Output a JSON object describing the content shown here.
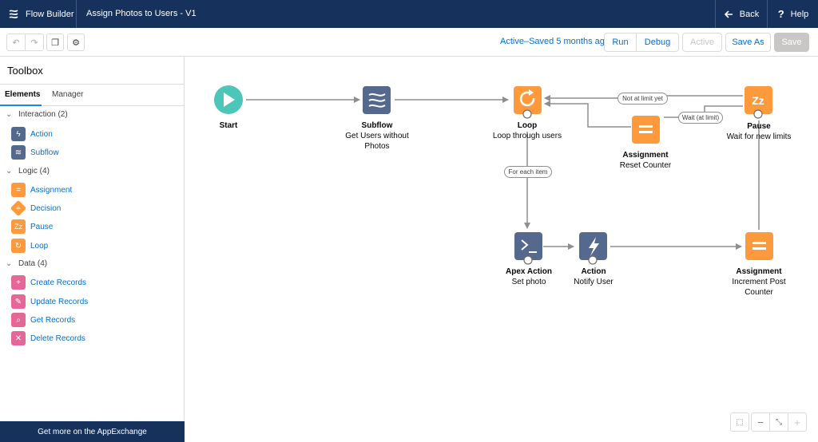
{
  "header": {
    "app_name": "Flow Builder",
    "flow_title": "Assign Photos to Users - V1",
    "back_label": "Back",
    "help_label": "Help"
  },
  "toolbar": {
    "status": "Active–Saved 5 months ago",
    "run_label": "Run",
    "debug_label": "Debug",
    "active_label": "Active",
    "save_as_label": "Save As",
    "save_label": "Save"
  },
  "sidebar": {
    "title": "Toolbox",
    "tabs": [
      "Elements",
      "Manager"
    ],
    "groups": [
      {
        "label": "Interaction (2)",
        "items": [
          {
            "label": "Action",
            "icon": "lightning-icon",
            "color": "#54698d"
          },
          {
            "label": "Subflow",
            "icon": "subflow-icon",
            "color": "#54698d"
          }
        ]
      },
      {
        "label": "Logic (4)",
        "items": [
          {
            "label": "Assignment",
            "icon": "equals-icon",
            "color": "#ff9a3c"
          },
          {
            "label": "Decision",
            "icon": "decision-icon",
            "color": "#ff9a3c"
          },
          {
            "label": "Pause",
            "icon": "pause-zz-icon",
            "color": "#ff9a3c"
          },
          {
            "label": "Loop",
            "icon": "loop-icon",
            "color": "#ff9a3c"
          }
        ]
      },
      {
        "label": "Data (4)",
        "items": [
          {
            "label": "Create Records",
            "icon": "create-record-icon",
            "color": "#e56798"
          },
          {
            "label": "Update Records",
            "icon": "update-record-icon",
            "color": "#e56798"
          },
          {
            "label": "Get Records",
            "icon": "get-record-icon",
            "color": "#e56798"
          },
          {
            "label": "Delete Records",
            "icon": "delete-record-icon",
            "color": "#e56798"
          }
        ]
      }
    ],
    "footer": "Get more on the AppExchange"
  },
  "canvas": {
    "nodes": {
      "start": {
        "title": "Start",
        "subtitle": ""
      },
      "subflow": {
        "title": "Subflow",
        "subtitle": "Get Users without Photos"
      },
      "loop": {
        "title": "Loop",
        "subtitle": "Loop through users"
      },
      "reset": {
        "title": "Assignment",
        "subtitle": "Reset Counter"
      },
      "pause": {
        "title": "Pause",
        "subtitle": "Wait for new limits"
      },
      "apex": {
        "title": "Apex Action",
        "subtitle": "Set photo"
      },
      "action": {
        "title": "Action",
        "subtitle": "Notify User"
      },
      "increment": {
        "title": "Assignment",
        "subtitle": "Increment Post Counter"
      }
    },
    "connector_labels": {
      "not_at_limit": "Not at limit yet",
      "wait_at_limit": "Wait (at limit)",
      "for_each": "For each item"
    }
  },
  "colors": {
    "header_bg": "#16325c",
    "start_green": "#4bc6b9",
    "slate": "#54698d",
    "orange": "#ff9a3c",
    "pink": "#e56798",
    "link_blue": "#0070d2"
  }
}
